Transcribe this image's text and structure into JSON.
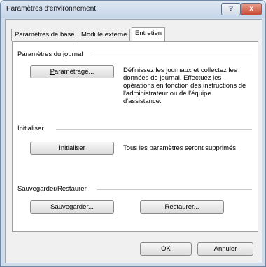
{
  "window": {
    "title": "Paramètres d'environnement",
    "help_button": "?",
    "close_button": "x"
  },
  "tabs": [
    {
      "label": "Paramètres de base",
      "active": false
    },
    {
      "label": "Module externe",
      "active": false
    },
    {
      "label": "Entretien",
      "active": true
    }
  ],
  "journal": {
    "heading": "Paramètres du journal",
    "button_first": "P",
    "button_rest": "aramétrage...",
    "description_lines": [
      "Définissez les journaux et collectez les",
      "données de journal. Effectuez les",
      "opérations en fonction des instructions de",
      "l'administrateur ou de l'équipe",
      "d'assistance."
    ]
  },
  "initialiser": {
    "heading": "Initialiser",
    "button_first": "I",
    "button_rest": "nitialiser",
    "description": "Tous les paramètres seront supprimés"
  },
  "backup": {
    "heading": "Sauvegarder/Restaurer",
    "save_pre": "S",
    "save_u": "a",
    "save_rest": "uvegarder...",
    "restore_first": "R",
    "restore_rest": "estaurer..."
  },
  "footer": {
    "ok": "OK",
    "cancel": "Annuler"
  }
}
